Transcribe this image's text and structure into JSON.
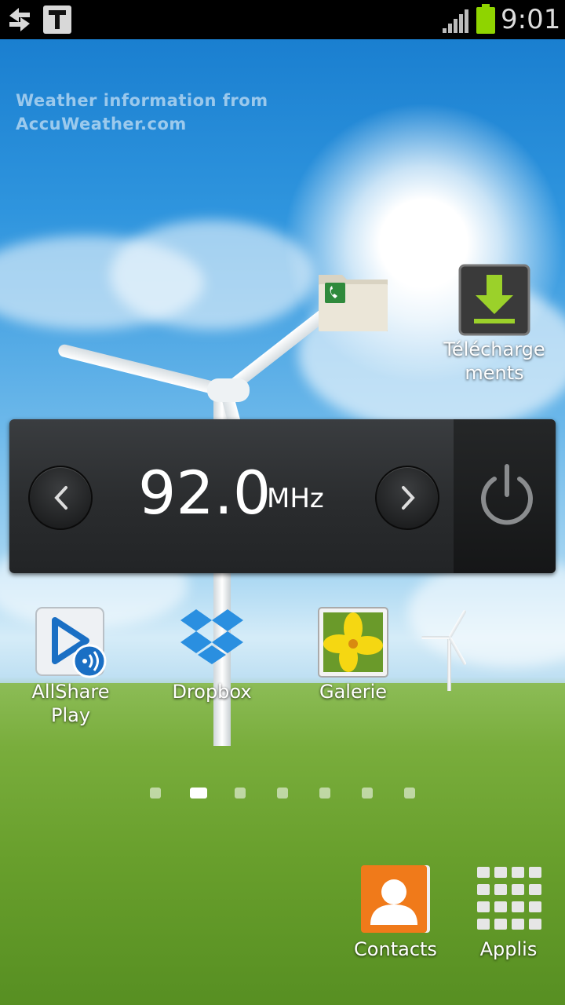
{
  "status_bar": {
    "time": "9:01",
    "left_icons": [
      "sync-icon",
      "t-app-icon"
    ],
    "signal": "signal-bars-icon",
    "battery": "battery-icon",
    "battery_color": "#8fd400"
  },
  "weather_widget": {
    "line1": "Weather information from",
    "line2": "AccuWeather.com"
  },
  "apps_top": [
    {
      "name": "folder",
      "label": ""
    },
    {
      "name": "downloads",
      "label_line1": "Télécharge",
      "label_line2": "ments"
    }
  ],
  "radio_widget": {
    "frequency": "92.0",
    "unit": "MHz"
  },
  "apps_middle": [
    {
      "name": "allshare-play",
      "label_line1": "AllShare",
      "label_line2": "Play"
    },
    {
      "name": "dropbox",
      "label": "Dropbox"
    },
    {
      "name": "galerie",
      "label": "Galerie"
    }
  ],
  "page_indicator": {
    "count": 7,
    "active": 2
  },
  "dock": [
    {
      "name": "contacts",
      "label": "Contacts"
    },
    {
      "name": "applis",
      "label": "Applis"
    }
  ]
}
